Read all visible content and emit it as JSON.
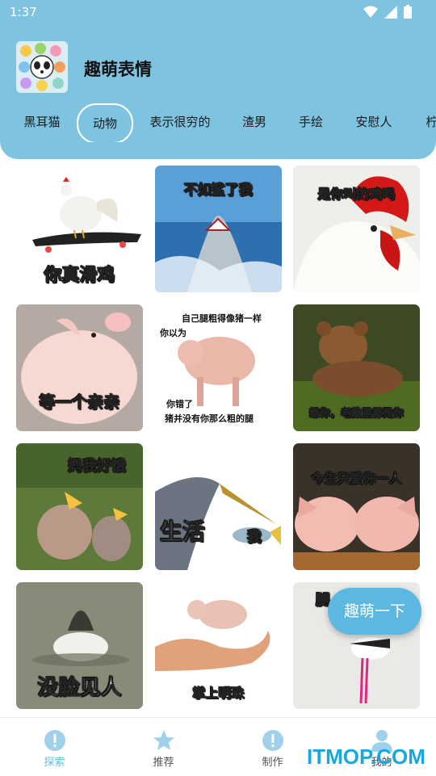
{
  "status_bar": {
    "time": "1:37"
  },
  "app": {
    "title": "趣萌表情"
  },
  "tabs": [
    {
      "label": "黑耳猫"
    },
    {
      "label": "动物",
      "active": true
    },
    {
      "label": "表示很穷的"
    },
    {
      "label": "渣男"
    },
    {
      "label": "手绘"
    },
    {
      "label": "安慰人"
    },
    {
      "label": "柠"
    }
  ],
  "stickers": [
    {
      "caption": "你真滑鸡"
    },
    {
      "caption": "不如鲨了我"
    },
    {
      "caption": "是你叫的鸡吗"
    },
    {
      "caption": "等一个亲亲"
    },
    {
      "caption": "自己腿粗得像猪一样",
      "caption2": "你以为",
      "caption3": "你错了",
      "caption4": "猪并没有你那么粗的腿"
    },
    {
      "caption": "想你，老戴里都是你"
    },
    {
      "caption": "妈我好饿"
    },
    {
      "caption": "生活",
      "caption2": "我"
    },
    {
      "caption": "今生只爱你一人"
    },
    {
      "caption": "没脸见人"
    },
    {
      "caption": "掌上明珠"
    },
    {
      "caption": "腿"
    }
  ],
  "fab": {
    "label": "趣萌一下"
  },
  "bottom_nav": [
    {
      "label": "探索",
      "icon": "explore-icon",
      "active": true
    },
    {
      "label": "推荐",
      "icon": "star-icon"
    },
    {
      "label": "制作",
      "icon": "info-icon"
    },
    {
      "label": "我的",
      "icon": "person-icon"
    }
  ],
  "watermark": "ITMOP.COM",
  "colors": {
    "header": "#7ec4e0",
    "accent": "#6ab8dc",
    "fab": "#5cb8e0",
    "nav_icon": "#9fd2ea"
  }
}
